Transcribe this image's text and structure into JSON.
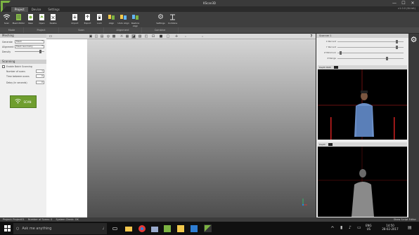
{
  "window": {
    "title": "KScan3D",
    "minimize": "—",
    "maximize": "☐",
    "close": "✕",
    "version": "v1.0.0 (64 bit)"
  },
  "tabs": [
    "Project",
    "Device",
    "Settings"
  ],
  "ribbon": [
    {
      "label": "Scan",
      "icon": "scan-wifi-icon"
    },
    {
      "label": "Mesh Editor",
      "icon": "mesh-editor-icon"
    },
    {
      "label": "New",
      "icon": "new-project-icon"
    },
    {
      "label": "Open",
      "icon": "open-project-icon"
    },
    {
      "label": "Delete",
      "icon": "delete-icon"
    },
    {
      "label": "Import",
      "icon": "import-icon"
    },
    {
      "label": "Export",
      "icon": "export-icon"
    },
    {
      "label": "Lock",
      "icon": "lock-icon"
    },
    {
      "label": "Align",
      "icon": "align-icon"
    },
    {
      "label": "Undo Align",
      "icon": "undo-align-icon"
    },
    {
      "label": "Restore Align",
      "icon": "restore-align-icon"
    },
    {
      "label": "Settings",
      "icon": "gear-icon"
    },
    {
      "label": "Combine",
      "icon": "combine-icon"
    }
  ],
  "ribbon_groups": [
    "Mode",
    "Project",
    "Scan",
    "Alignment",
    "Combine"
  ],
  "left": {
    "meshing_title": "Meshing",
    "generate_label": "Generate",
    "generate_value": "Mesh",
    "alignment_label": "Alignment",
    "alignment_value": "Mesh Geometry",
    "density_label": "Density",
    "scanning_title": "Scanning",
    "enable_batch": "Enable Batch Scanning",
    "num_scans_label": "Number of scans",
    "num_scans_value": "1",
    "time_between_label": "Time between scans",
    "time_between_value": "0",
    "delay_label": "Delay (in seconds)",
    "delay_value": "0",
    "scan_button": "SCAN"
  },
  "viewport": {
    "field1": "0",
    "field2": "0"
  },
  "scanner": {
    "title": "Scanner 1",
    "sliders": [
      {
        "label": "X Percent",
        "value": 0.9
      },
      {
        "label": "Y Percent",
        "value": 0.9
      },
      {
        "label": "Z Minimum",
        "value": 0.05
      },
      {
        "label": "Z Range",
        "value": 0.75
      }
    ],
    "rgb_tab": "Depth RGB",
    "depth_tab": "Depth"
  },
  "status": {
    "project": "Project: Project01",
    "scans": "Number of Scans: 0",
    "system": "System Check: OK",
    "right": "Show Script Editor"
  },
  "taskbar": {
    "search_placeholder": "Ask me anything",
    "lang": "ENG",
    "region": "US",
    "time": "14:50",
    "date": "28-02-2017"
  },
  "colors": {
    "accent_green": "#6f9e2f",
    "crosshair": "#d02020",
    "background": "#2b2b2b"
  }
}
